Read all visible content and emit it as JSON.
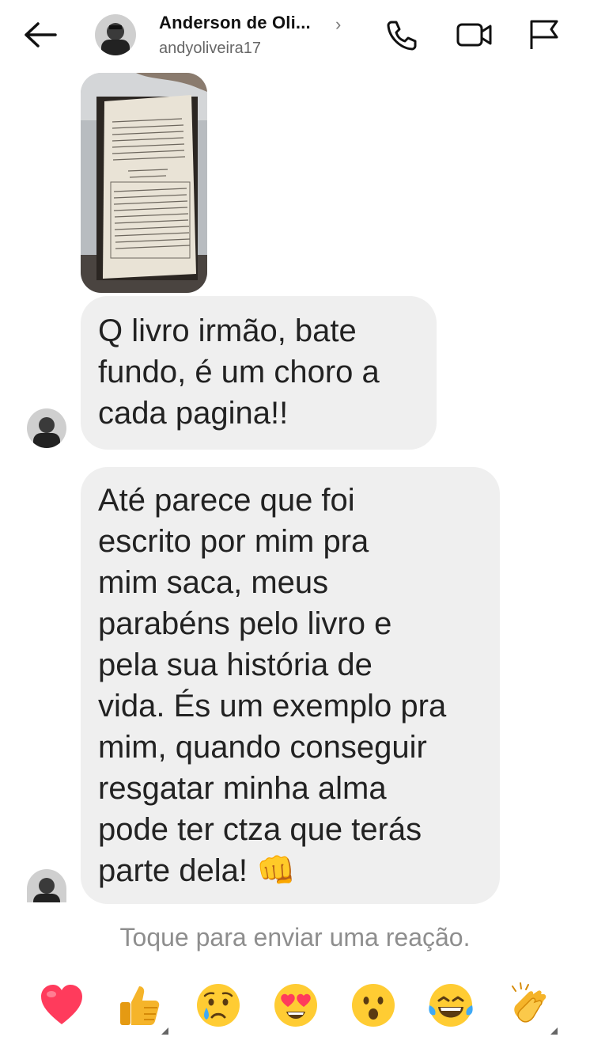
{
  "header": {
    "name": "Anderson de Oli...",
    "chevron": "›",
    "username": "andyoliveira17",
    "icons": [
      "back-arrow-icon",
      "phone-icon",
      "video-icon",
      "flag-icon"
    ]
  },
  "messages": [
    {
      "type": "image",
      "description_icon": "book-photo"
    },
    {
      "type": "text",
      "text": "Q livro irmão, bate\nfundo, é um choro a\ncada pagina!!"
    },
    {
      "type": "text",
      "text": "Até parece que foi\nescrito por mim pra\nmim saca, meus\nparabéns pelo livro e\npela sua história de\nvida. És um exemplo pra\nmim, quando conseguir\nresgatar minha alma\npode ter ctza que terás\nparte dela! 👊"
    }
  ],
  "reaction_hint": "Toque para enviar uma reação.",
  "reactions": [
    "❤️",
    "👍",
    "😢",
    "😍",
    "😮",
    "😂",
    "👏"
  ],
  "colors": {
    "bubble": "#efefef",
    "hint": "#8e8e8e",
    "heart": "#ff3b5c"
  }
}
